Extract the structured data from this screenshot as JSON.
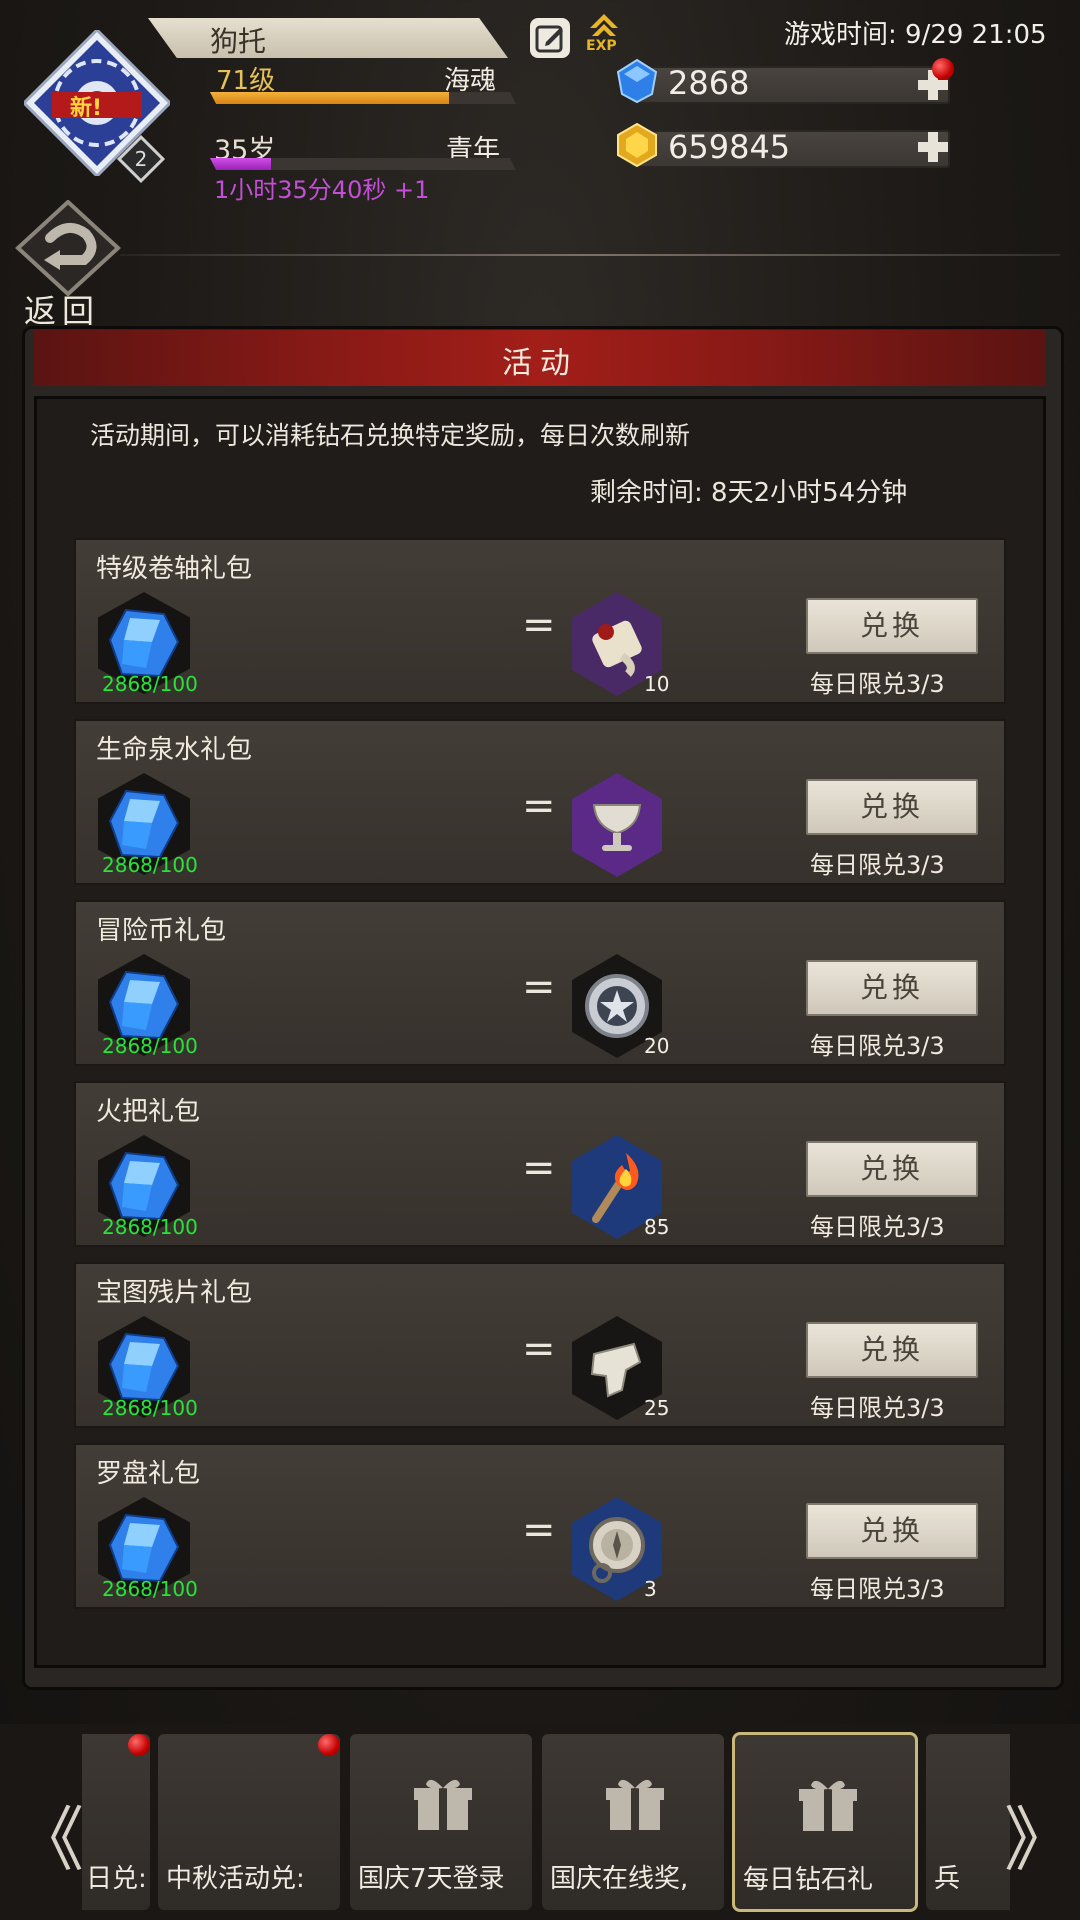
{
  "header": {
    "player_name": "狗托",
    "level": "71级",
    "level_progress": 0.78,
    "title": "海魂",
    "age": "35岁",
    "age_progress": 0.2,
    "age_stage": "青年",
    "age_timer": "1小时35分40秒 +1",
    "avatar_new_badge": "新!",
    "avatar_count": "2",
    "game_time": "游戏时间: 9/29 21:05",
    "exp_label": "EXP",
    "diamonds": "2868",
    "gold": "659845",
    "back_label": "返回"
  },
  "panel": {
    "title": "活动",
    "description": "活动期间，可以消耗钻石兑换特定奖励，每日次数刷新",
    "remaining": "剩余时间: 8天2小时54分钟",
    "equals_sign": "="
  },
  "offers": [
    {
      "title": "特级卷轴礼包",
      "cost": "2868/100",
      "reward_icon": "scroll-icon",
      "qty": "10",
      "button": "兑换",
      "limit": "每日限兑3/3",
      "frame": "#4a2a66"
    },
    {
      "title": "生命泉水礼包",
      "cost": "2868/100",
      "reward_icon": "chalice-icon",
      "qty": "",
      "button": "兑换",
      "limit": "每日限兑3/3",
      "frame": "#5a2a86"
    },
    {
      "title": "冒险币礼包",
      "cost": "2868/100",
      "reward_icon": "coin-icon",
      "qty": "20",
      "button": "兑换",
      "limit": "每日限兑3/3",
      "frame": "#181614"
    },
    {
      "title": "火把礼包",
      "cost": "2868/100",
      "reward_icon": "torch-icon",
      "qty": "85",
      "button": "兑换",
      "limit": "每日限兑3/3",
      "frame": "#1e3a7a"
    },
    {
      "title": "宝图残片礼包",
      "cost": "2868/100",
      "reward_icon": "map-fragment-icon",
      "qty": "25",
      "button": "兑换",
      "limit": "每日限兑3/3",
      "frame": "#181614"
    },
    {
      "title": "罗盘礼包",
      "cost": "2868/100",
      "reward_icon": "compass-icon",
      "qty": "3",
      "button": "兑换",
      "limit": "每日限兑3/3",
      "frame": "#1e3a7a"
    }
  ],
  "tabs": [
    {
      "label": "日兑:",
      "notify": true,
      "gift": false,
      "active": false
    },
    {
      "label": "中秋活动兑:",
      "notify": true,
      "gift": false,
      "active": false
    },
    {
      "label": "国庆7天登录",
      "notify": false,
      "gift": true,
      "active": false
    },
    {
      "label": "国庆在线奖,",
      "notify": false,
      "gift": true,
      "active": false
    },
    {
      "label": "每日钻石礼",
      "notify": false,
      "gift": true,
      "active": true
    },
    {
      "label": "兵",
      "notify": false,
      "gift": false,
      "active": false
    }
  ],
  "nav": {
    "prev": "《",
    "next": "》"
  }
}
